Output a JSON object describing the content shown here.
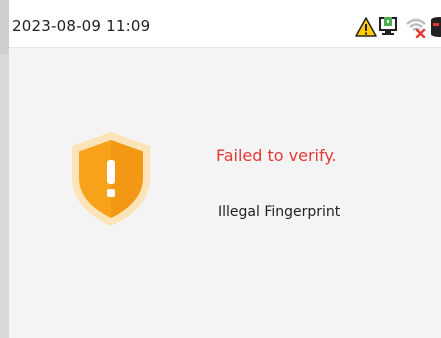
{
  "status_bar": {
    "datetime": "2023-08-09 11:09",
    "icons": [
      "warning-icon",
      "network-connected-icon",
      "wifi-disconnected-icon",
      "database-icon"
    ]
  },
  "dialog": {
    "title": "Failed to verify.",
    "detail": "Illegal Fingerprint",
    "icon": "shield-alert-icon"
  },
  "colors": {
    "error_text": "#e53935",
    "shield_orange": "#f7a21a",
    "shield_glow": "#fde3b8",
    "network_green": "#4caf50",
    "wifi_off_red": "#e53935"
  }
}
